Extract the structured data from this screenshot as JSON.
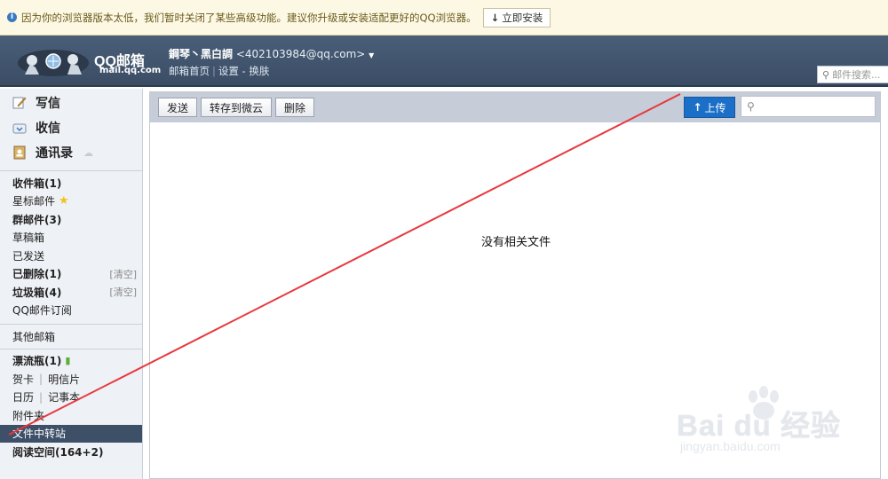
{
  "warning": {
    "text": "因为你的浏览器版本太低，我们暂时关闭了某些高级功能。建议你升级或安装适配更好的QQ浏览器。",
    "install_label": "立即安装"
  },
  "header": {
    "logo_name": "QQ邮箱",
    "logo_domain": "mail.qq.com",
    "user_name": "鋼琴丶黑白調",
    "user_email": "<402103984@qq.com>",
    "links": {
      "home": "邮箱首页",
      "settings": "设置",
      "dash": "-",
      "skin": "换肤",
      "sep": "|"
    },
    "search_placeholder": "邮件搜索..."
  },
  "sidebar": {
    "actions": [
      {
        "label": "写信"
      },
      {
        "label": "收信"
      },
      {
        "label": "通讯录"
      }
    ],
    "folders": {
      "inbox": "收件箱(1)",
      "starred": "星标邮件",
      "group": "群邮件(3)",
      "drafts": "草稿箱",
      "sent": "已发送",
      "deleted": "已删除(1)",
      "spam": "垃圾箱(4)",
      "subscriptions": "QQ邮件订阅",
      "other": "其他邮箱",
      "bottle": "漂流瓶(1)",
      "card": "贺卡",
      "postcard": "明信片",
      "calendar": "日历",
      "notes": "记事本",
      "attachments": "附件夹",
      "transfer": "文件中转站",
      "reading": "阅读空间(164+2)",
      "clear": "[清空]",
      "pipe": "|"
    }
  },
  "toolbar": {
    "send": "发送",
    "save_cloud": "转存到微云",
    "delete": "删除",
    "upload": "上传"
  },
  "main": {
    "empty_text": "没有相关文件"
  },
  "watermark": {
    "brand": "Bai du 经验",
    "site": "jingyan.baidu.com"
  },
  "colors": {
    "header_bg": "#3f526b",
    "active_folder": "#3e5068",
    "upload_button": "#1c6fc7",
    "annotation_line": "#e8383d"
  }
}
